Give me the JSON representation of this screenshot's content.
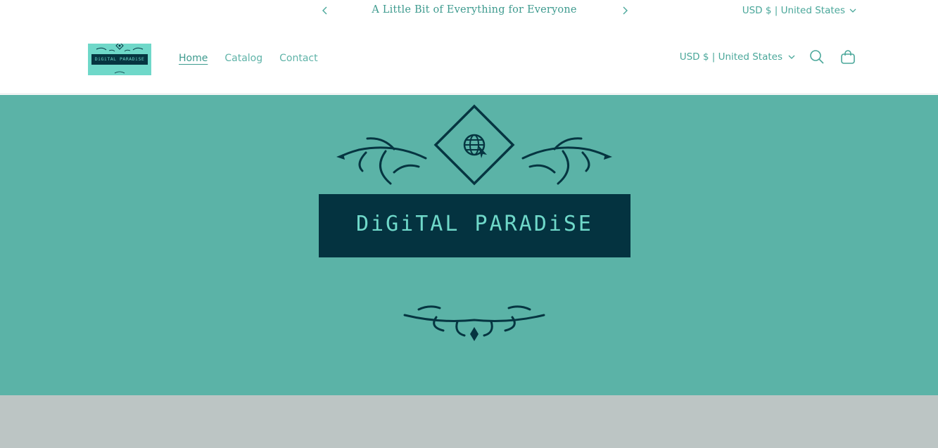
{
  "announcement": {
    "message": "A Little Bit of Everything for Everyone",
    "locale": "USD $ | United States",
    "prev_icon": "chevron-left-icon",
    "next_icon": "chevron-right-icon"
  },
  "header": {
    "logo_text": "DiGiTAL PARADiSE",
    "nav": [
      "Home",
      "Catalog",
      "Contact"
    ],
    "active_nav": "Home",
    "locale": "USD $ | United States",
    "icons": [
      "search-icon",
      "cart-icon",
      "chevron-down-icon"
    ]
  },
  "hero": {
    "brand_text": "DiGiTAL PARADiSE",
    "globe_icon": "globe-cursor-icon"
  },
  "colors": {
    "accent": "#4aa79a",
    "hero_bg": "#5bb3a7",
    "brand_dark": "#043340",
    "brand_light": "#6fd8c9",
    "lower_band": "#bcc5c4"
  }
}
